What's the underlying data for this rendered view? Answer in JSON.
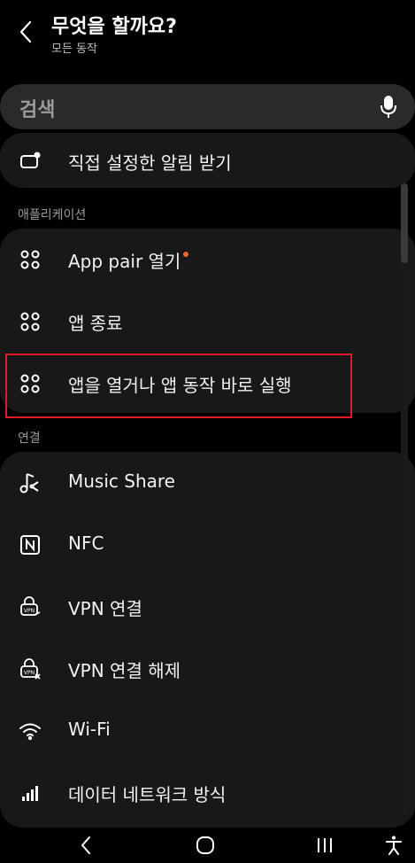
{
  "header": {
    "title": "무엇을 할까요?",
    "subtitle": "모든 동작"
  },
  "search": {
    "placeholder": "검색"
  },
  "top_item": {
    "label": "직접 설정한 알림 받기",
    "icon": "notification-icon"
  },
  "sections": [
    {
      "title": "애플리케이션",
      "items": [
        {
          "label": "App pair 열기",
          "icon": "apps-icon",
          "new_badge": true
        },
        {
          "label": "앱 종료",
          "icon": "apps-icon"
        },
        {
          "label": "앱을 열거나 앱 동작 바로 실행",
          "icon": "apps-icon",
          "highlighted": true
        }
      ]
    },
    {
      "title": "연결",
      "items": [
        {
          "label": "Music Share",
          "icon": "music-share-icon"
        },
        {
          "label": "NFC",
          "icon": "nfc-icon"
        },
        {
          "label": "VPN 연결",
          "icon": "vpn-lock-icon"
        },
        {
          "label": "VPN 연결 해제",
          "icon": "vpn-disconnect-icon"
        },
        {
          "label": "Wi-Fi",
          "icon": "wifi-icon"
        },
        {
          "label": "데이터 네트워크 방식",
          "icon": "signal-icon"
        }
      ]
    }
  ],
  "colors": {
    "background": "#000000",
    "card": "#181818",
    "badge": "#f0622a",
    "highlight_border": "#e01b24"
  }
}
